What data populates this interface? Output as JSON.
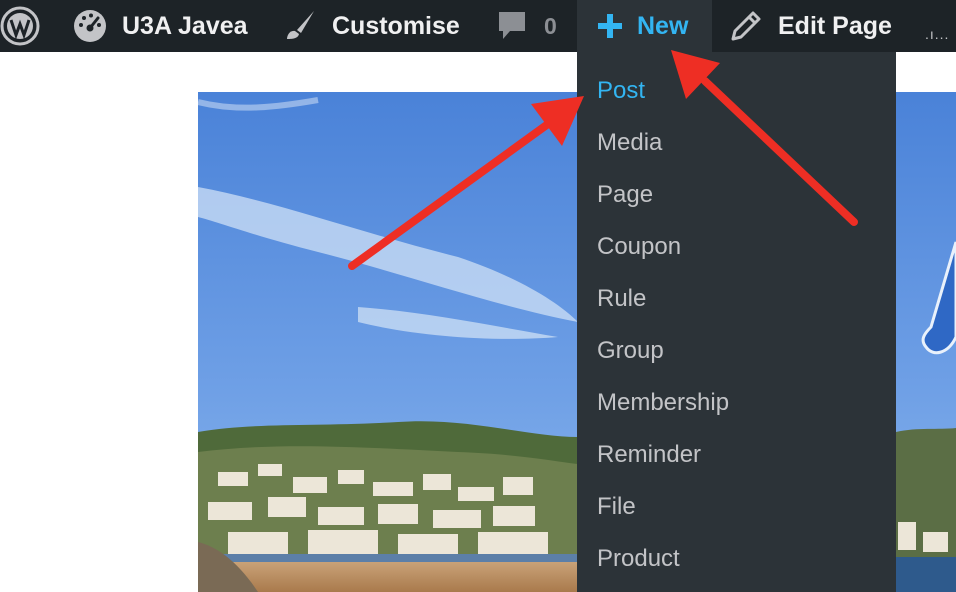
{
  "adminbar": {
    "site_name": "U3A Javea",
    "customise_label": "Customise",
    "comments_count": "0",
    "new_label": "New",
    "edit_page_label": "Edit Page",
    "more_label": ".ı..."
  },
  "new_menu": {
    "items": [
      "Post",
      "Media",
      "Page",
      "Coupon",
      "Rule",
      "Group",
      "Membership",
      "Reminder",
      "File",
      "Product"
    ],
    "active": "Post"
  },
  "colors": {
    "adminbar_bg": "#1d2327",
    "menu_bg": "#2c3338",
    "highlight": "#33b5f2",
    "annotation_arrow": "#ee2e24"
  }
}
